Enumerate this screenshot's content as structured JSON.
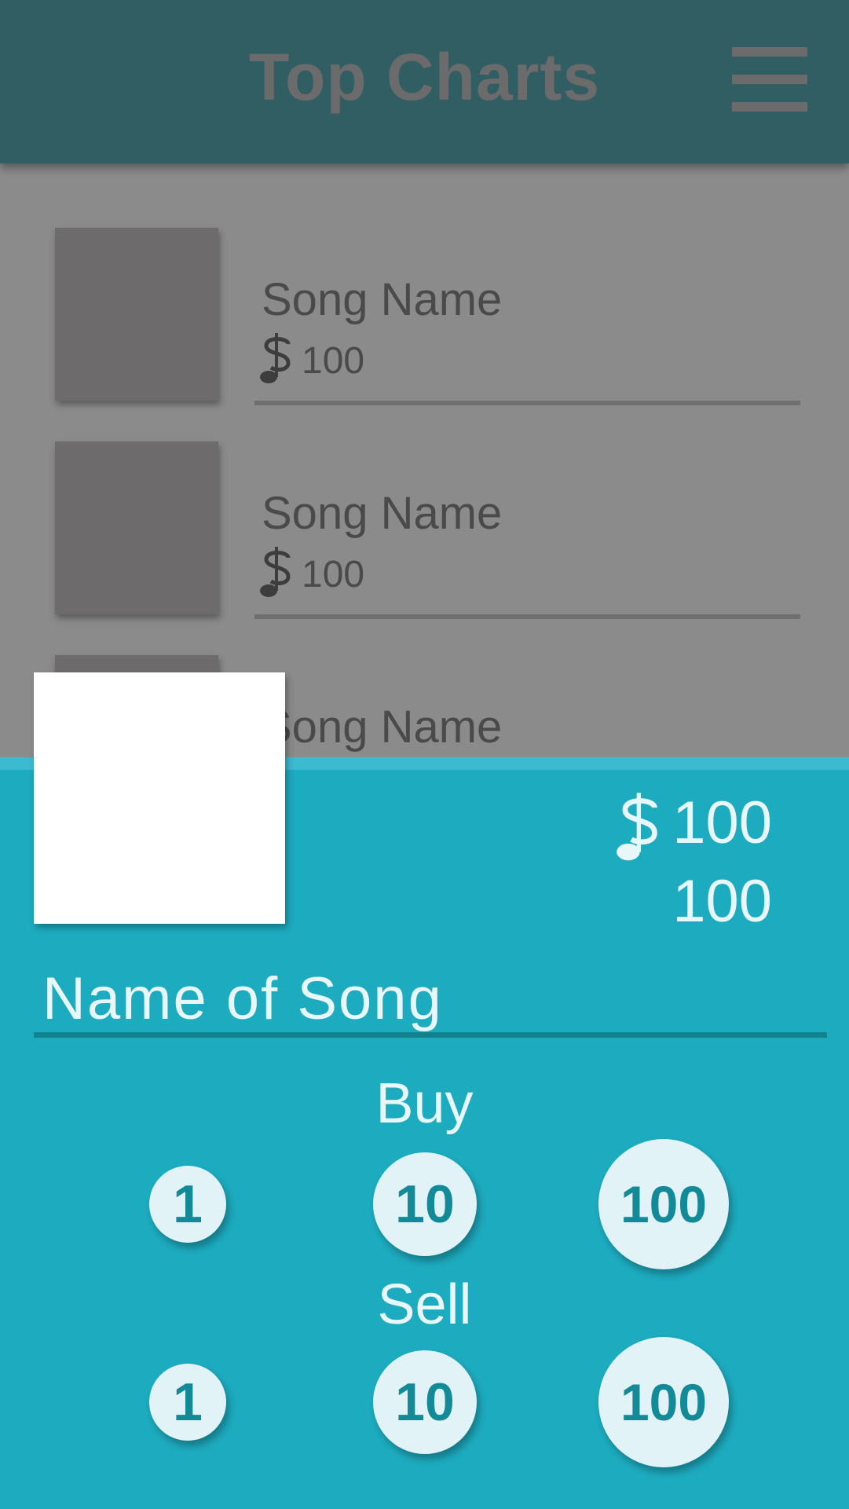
{
  "app_bar": {
    "title": "Top Charts",
    "menu_icon": "hamburger-menu-icon"
  },
  "list": {
    "items": [
      {
        "name": "Song Name",
        "currency_icon": "music-note-dollar-icon",
        "price": "100"
      },
      {
        "name": "Song Name",
        "currency_icon": "music-note-dollar-icon",
        "price": "100"
      },
      {
        "name": "Song Name"
      }
    ]
  },
  "detail": {
    "currency_icon": "music-note-dollar-icon",
    "price": "100",
    "quantity": "100",
    "song_title": "Name of Song",
    "buy": {
      "label": "Buy",
      "amounts": [
        "1",
        "10",
        "100"
      ]
    },
    "sell": {
      "label": "Sell",
      "amounts": [
        "1",
        "10",
        "100"
      ]
    }
  },
  "colors": {
    "app_bar": "#315e63",
    "dim_overlay": "#8a8b8a",
    "sheet": "#1dabbf",
    "button_fill": "#e2f3f8",
    "button_text": "#138a98"
  }
}
